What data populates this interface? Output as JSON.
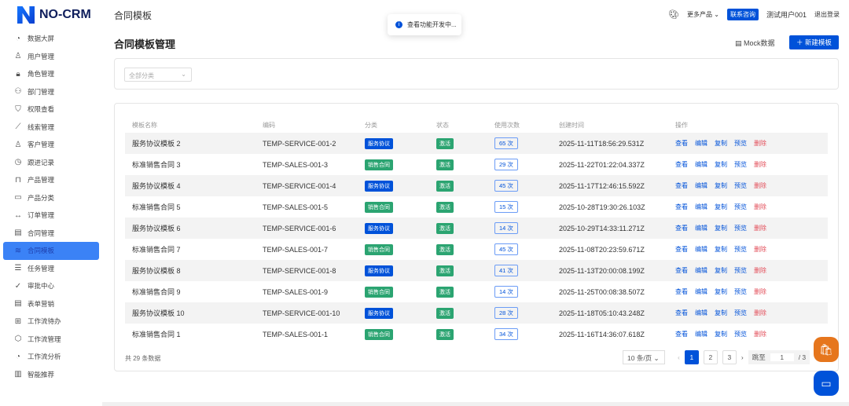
{
  "app": {
    "name": "NO-CRM",
    "header_title": "合同模板",
    "more_products": "更多产品",
    "contact": "联系咨询",
    "user": "测试用户001",
    "logout": "退出登录"
  },
  "toast": "查看功能开发中...",
  "sidebar": [
    {
      "label": "数据大屏",
      "icon": "◔"
    },
    {
      "label": "用户管理",
      "icon": "♙"
    },
    {
      "label": "角色管理",
      "icon": "🔒︎"
    },
    {
      "label": "部门管理",
      "icon": "⚇"
    },
    {
      "label": "权限查看",
      "icon": "⛉"
    },
    {
      "label": "线索管理",
      "icon": "⟋"
    },
    {
      "label": "客户管理",
      "icon": "♙"
    },
    {
      "label": "跟进记录",
      "icon": "◷"
    },
    {
      "label": "产品管理",
      "icon": "⊓"
    },
    {
      "label": "产品分类",
      "icon": "▭"
    },
    {
      "label": "订单管理",
      "icon": "↔"
    },
    {
      "label": "合同管理",
      "icon": "▤"
    },
    {
      "label": "合同模板",
      "icon": "≋"
    },
    {
      "label": "任务管理",
      "icon": "☰"
    },
    {
      "label": "审批中心",
      "icon": "✓"
    },
    {
      "label": "表单营销",
      "icon": "▤"
    },
    {
      "label": "工作流待办",
      "icon": "⊞"
    },
    {
      "label": "工作流管理",
      "icon": "⬡"
    },
    {
      "label": "工作流分析",
      "icon": "◔"
    },
    {
      "label": "智能推荐",
      "icon": "▥"
    }
  ],
  "page": {
    "title": "合同模板管理",
    "mock": "Mock数据",
    "new": "新建模板",
    "filter": "全部分类"
  },
  "table": {
    "headers": [
      "模板名称",
      "编码",
      "分类",
      "状态",
      "使用次数",
      "创建时间",
      "操作"
    ],
    "actions": [
      "查看",
      "编辑",
      "复制",
      "预览",
      "删除"
    ],
    "rows": [
      [
        "服务协议模板 2",
        "TEMP-SERVICE-001-2",
        "服务协议",
        "激活",
        "65 次",
        "2025-11-11T18:56:29.531Z"
      ],
      [
        "标准销售合同 3",
        "TEMP-SALES-001-3",
        "销售合同",
        "激活",
        "29 次",
        "2025-11-22T01:22:04.337Z"
      ],
      [
        "服务协议模板 4",
        "TEMP-SERVICE-001-4",
        "服务协议",
        "激活",
        "45 次",
        "2025-11-17T12:46:15.592Z"
      ],
      [
        "标准销售合同 5",
        "TEMP-SALES-001-5",
        "销售合同",
        "激活",
        "15 次",
        "2025-10-28T19:30:26.103Z"
      ],
      [
        "服务协议模板 6",
        "TEMP-SERVICE-001-6",
        "服务协议",
        "激活",
        "14 次",
        "2025-10-29T14:33:11.271Z"
      ],
      [
        "标准销售合同 7",
        "TEMP-SALES-001-7",
        "销售合同",
        "激活",
        "45 次",
        "2025-11-08T20:23:59.671Z"
      ],
      [
        "服务协议模板 8",
        "TEMP-SERVICE-001-8",
        "服务协议",
        "激活",
        "41 次",
        "2025-11-13T20:00:08.199Z"
      ],
      [
        "标准销售合同 9",
        "TEMP-SALES-001-9",
        "销售合同",
        "激活",
        "14 次",
        "2025-11-25T00:08:38.507Z"
      ],
      [
        "服务协议模板 10",
        "TEMP-SERVICE-001-10",
        "服务协议",
        "激活",
        "28 次",
        "2025-11-18T05:10:43.248Z"
      ],
      [
        "标准销售合同 1",
        "TEMP-SALES-001-1",
        "销售合同",
        "激活",
        "34 次",
        "2025-11-16T14:36:07.618Z"
      ]
    ]
  },
  "pagination": {
    "total": "共 29 条数据",
    "page_size": "10 条/页",
    "pages": [
      "1",
      "2",
      "3"
    ],
    "jump_label": "跳至",
    "jump_value": "1",
    "of": "/ 3"
  }
}
